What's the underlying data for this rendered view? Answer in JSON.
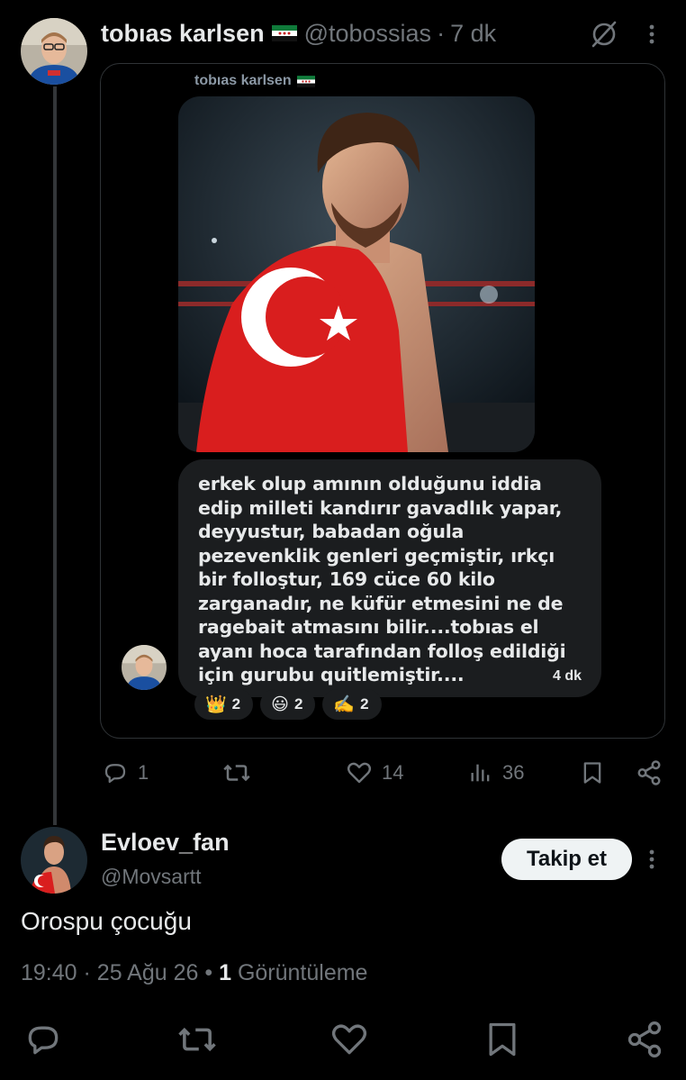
{
  "post": {
    "author_name": "tobıas karlsen",
    "author_handle": "@tobossias",
    "separator": "·",
    "time": "7 dk",
    "card": {
      "sender_name": "tobıas karlsen",
      "message": "erkek olup amının olduğunu iddia edip milleti kandırır gavadlık yapar, deyyustur, babadan oğula pezevenklik genleri geçmiştir, ırkçı bir folloştur, 169 cüce 60 kilo zarganadır, ne küfür etmesini ne de ragebait atmasını bilir....tobıas el ayanı hoca tarafından folloş edildiği için gurubu quitlemiştir....",
      "message_time": "4 dk",
      "reactions": [
        {
          "emoji": "👑",
          "count": "2"
        },
        {
          "emoji": "😃",
          "count": "2"
        },
        {
          "emoji": "✍️",
          "count": "2"
        }
      ]
    },
    "actions": {
      "replies": "1",
      "likes": "14",
      "views": "36"
    }
  },
  "reply": {
    "author_name": "Evloev_fan",
    "author_handle": "@Movsartt",
    "follow_label": "Takip et",
    "text": "Orospu çocuğu",
    "time": "19:40",
    "date": "25 Ağu 26",
    "views_count": "1",
    "views_label": "Görüntüleme"
  },
  "colors": {
    "background": "#000000",
    "text_primary": "#e7e9ea",
    "text_secondary": "#71767b",
    "bubble": "#1b1d1f",
    "follow_button": "#eff3f4"
  },
  "icons": [
    "grok-icon",
    "more-icon",
    "reply-icon",
    "repost-icon",
    "like-icon",
    "views-icon",
    "bookmark-icon",
    "share-icon"
  ]
}
